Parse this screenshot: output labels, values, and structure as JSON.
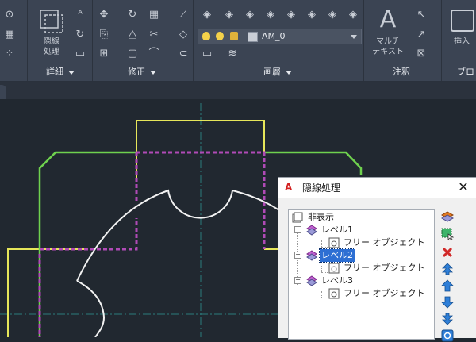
{
  "ribbon": {
    "groups": [
      {
        "label": "詳細"
      },
      {
        "label": "修正"
      },
      {
        "label": "画層"
      },
      {
        "label": "注釈"
      },
      {
        "label": "ブロッ"
      }
    ],
    "hidden_line_button": {
      "line1": "隠線",
      "line2": "処理"
    },
    "mtext_button": {
      "line1": "マルチ",
      "line2": "テキスト"
    },
    "insert_button": {
      "label": "挿入"
    },
    "current_layer": "AM_0",
    "colors": {
      "ribbon_bg": "#3b4453",
      "text": "#e6e9ee"
    }
  },
  "canvas": {
    "background": "#212830",
    "colors": {
      "yellow": "#e6e65a",
      "green": "#6fd14e",
      "magenta": "#b04ab6",
      "white": "#f2f2f2",
      "center": "#2a8a8a"
    }
  },
  "dialog": {
    "title": "隠線処理",
    "close_icon": "close-icon",
    "tree": [
      {
        "label": "非表示",
        "level": 0,
        "icon": "hidden-items-icon"
      },
      {
        "label": "レベル1",
        "level": 1,
        "icon": "layer-level-icon",
        "expanded": true
      },
      {
        "label": "フリー オブジェクト",
        "level": 2,
        "icon": "free-object-icon"
      },
      {
        "label": "レベル2",
        "level": 1,
        "icon": "layer-level-icon",
        "expanded": true,
        "selected": true
      },
      {
        "label": "フリー オブジェクト",
        "level": 2,
        "icon": "free-object-icon"
      },
      {
        "label": "レベル3",
        "level": 1,
        "icon": "layer-level-icon",
        "expanded": true
      },
      {
        "label": "フリー オブジェクト",
        "level": 2,
        "icon": "free-object-icon"
      }
    ],
    "side_buttons": [
      "new-level-icon",
      "select-objects-icon",
      "delete-icon",
      "move-to-top-icon",
      "move-up-icon",
      "move-down-icon",
      "move-to-bottom-icon",
      "settings-icon"
    ]
  }
}
